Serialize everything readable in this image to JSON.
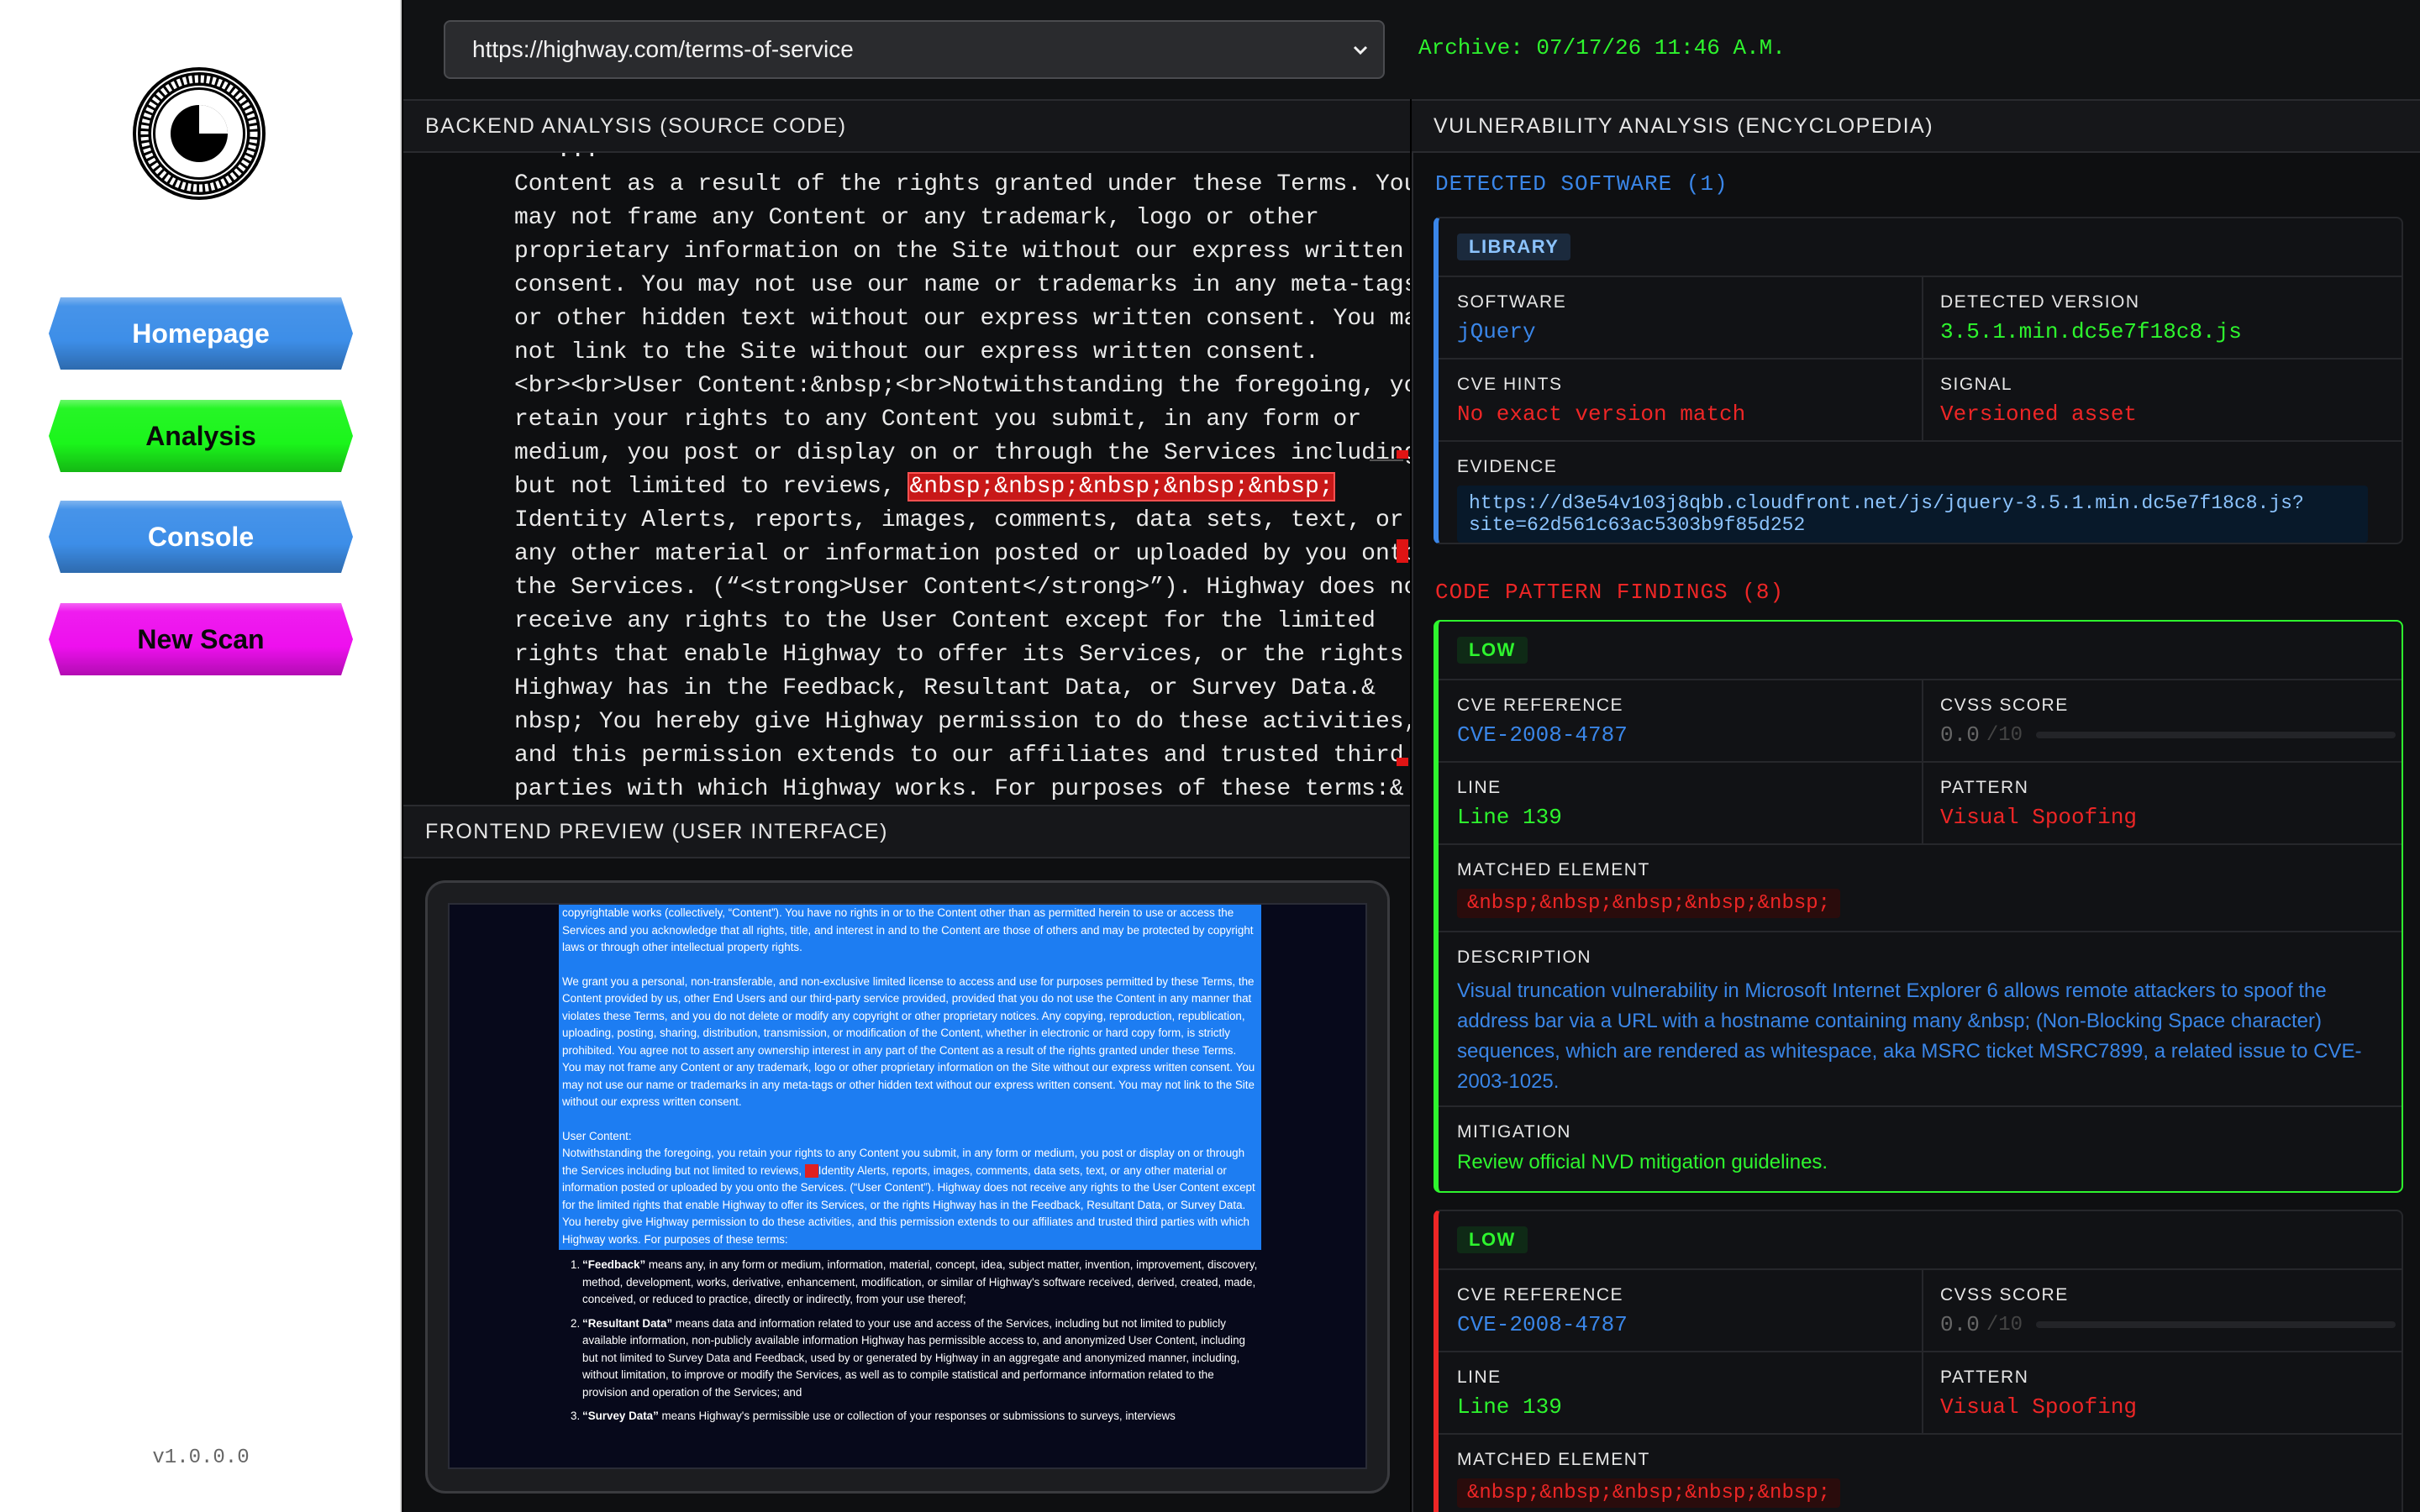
{
  "sidebar": {
    "nav": [
      {
        "label": "Homepage"
      },
      {
        "label": "Analysis"
      },
      {
        "label": "Console"
      },
      {
        "label": "New Scan"
      }
    ],
    "version": "v1.0.0.0"
  },
  "topbar": {
    "url": "https://highway.com/terms-of-service",
    "archive": "Archive: 07/17/26 11:46 A.M."
  },
  "panels": {
    "backend_title": "BACKEND ANALYSIS (SOURCE CODE)",
    "frontend_title": "FRONTEND PREVIEW (USER INTERFACE)",
    "vuln_title": "VULNERABILITY ANALYSIS (ENCYCLOPEDIA)"
  },
  "code": {
    "lines": [
      "Content as a result of the rights granted under these Terms. You",
      "may not frame any Content or any trademark, logo or other",
      "proprietary information on the Site without our express written",
      "consent. You may not use our name or trademarks in any meta-tags",
      "or other hidden text without our express written consent. You may",
      "not link to the Site without our express written consent.",
      "<br><br>User Content:&nbsp;<br>Notwithstanding the foregoing, you",
      "retain your rights to any Content you submit, in any form or",
      "medium, you post or display on or through the Services including"
    ],
    "highlight_prefix": "but not limited to reviews, ",
    "highlight_text": "&nbsp;&nbsp;&nbsp;&nbsp;&nbsp;",
    "lines_after": [
      "Identity Alerts, reports, images, comments, data sets, text, or",
      "any other material or information posted or uploaded by you onto",
      "the Services. (“<strong>User Content</strong>”). Highway does not",
      "receive any rights to the User Content except for the limited",
      "rights that enable Highway to offer its Services, or the rights",
      "Highway has in the Feedback, Resultant Data, or Survey Data.&",
      "nbsp; You hereby give Highway permission to do these activities,",
      "and this permission extends to our affiliates and trusted third",
      "parties with which Highway works. For purposes of these terms:&"
    ]
  },
  "preview": {
    "p1": "copyrightable works (collectively, “Content”). You have no rights in or to the Content other than as permitted herein to use or access the Services and you acknowledge that all rights, title, and interest in and to the Content are those of others and may be protected by copyright laws or through other intellectual property rights.",
    "p2": "We grant you a personal, non-transferable, and non-exclusive limited license to access and use for purposes permitted by these Terms, the Content provided by us, other End Users and our third-party service provided, provided that you do not use the Content in any manner that violates these Terms, and you do not delete or modify any copyright or other proprietary notices. Any copying, reproduction, republication, uploading, posting, sharing, distribution, transmission, or modification of the Content, whether in electronic or hard copy form, is strictly prohibited. You agree not to assert any ownership interest in any part of the Content as a result of the rights granted under these Terms. You may not frame any Content or any trademark, logo or other proprietary information on the Site without our express written consent. You may not use our name or trademarks in any meta-tags or other hidden text without our express written consent. You may not link to the Site without our express written consent.",
    "uc_heading": "User Content:",
    "p3a": "Notwithstanding the foregoing, you retain your rights to any Content you submit, in any form or medium, you post or display on or through the Services including but not limited to reviews, ",
    "p3b": "Identity Alerts, reports, images, comments, data sets, text, or any other material or information posted or uploaded by you onto the Services. (“User Content”). Highway does not receive any rights to the User Content except for the limited rights that enable Highway to offer its Services, or the rights Highway has in the Feedback, Resultant Data, or Survey Data.  You hereby give Highway permission to do these activities, and this permission extends to our affiliates and trusted third parties with which Highway works. For purposes of these terms:",
    "li1_num": "1.",
    "li1_bold": "“Feedback”",
    "li1": " means any, in any form or medium, information, material, concept, idea, subject matter, invention, improvement, discovery, method, development, works, derivative, enhancement, modification, or similar of Highway's software received, derived, created, made, conceived, or reduced to practice, directly or indirectly, from your use thereof;",
    "li2_num": "2.",
    "li2_bold": "“Resultant Data”",
    "li2": " means data and information related to your use and access of the Services, including but not limited to publicly available information, non-publicly available information Highway has permissible access to, and anonymized User Content, including but not limited to Survey Data and Feedback, used by or generated by Highway in an aggregate and anonymized manner, including, without limitation, to improve or modify the Services, as well as to compile statistical and performance information related to the provision and operation of the Services; and",
    "li3_num": "3.",
    "li3_bold": "“Survey Data”",
    "li3": " means Highway's permissible use or collection of your responses or submissions to surveys, interviews"
  },
  "vuln": {
    "detected_title": "DETECTED SOFTWARE (1)",
    "library_badge": "LIBRARY",
    "software_label": "SOFTWARE",
    "software_value": "jQuery",
    "version_label": "DETECTED VERSION",
    "version_value": "3.5.1.min.dc5e7f18c8.js",
    "cve_hints_label": "CVE HINTS",
    "cve_hints_value": "No exact version match",
    "signal_label": "SIGNAL",
    "signal_value": "Versioned asset",
    "evidence_label": "EVIDENCE",
    "evidence_value": "https://d3e54v103j8qbb.cloudfront.net/js/jquery-3.5.1.min.dc5e7f18c8.js?site=62d561c63ac5303b9f85d252",
    "findings_title": "CODE PATTERN FINDINGS (8)",
    "findings": [
      {
        "severity": "LOW",
        "cve_label": "CVE REFERENCE",
        "cve": "CVE-2008-4787",
        "cvss_label": "CVSS SCORE",
        "cvss": "0.0",
        "cvss_max": "/10",
        "line_label": "LINE",
        "line": "Line 139",
        "pattern_label": "PATTERN",
        "pattern": "Visual Spoofing",
        "matched_label": "MATCHED ELEMENT",
        "matched": "&nbsp;&nbsp;&nbsp;&nbsp;&nbsp;",
        "desc_label": "DESCRIPTION",
        "desc": "Visual truncation vulnerability in Microsoft Internet Explorer 6 allows remote attackers to spoof the address bar via a URL with a hostname containing many &nbsp; (Non-Blocking Space character) sequences, which are rendered as whitespace, aka MSRC ticket MSRC7899, a related issue to CVE-2003-1025.",
        "mitigation_label": "MITIGATION",
        "mitigation": "Review official NVD mitigation guidelines."
      },
      {
        "severity": "LOW",
        "cve_label": "CVE REFERENCE",
        "cve": "CVE-2008-4787",
        "cvss_label": "CVSS SCORE",
        "cvss": "0.0",
        "cvss_max": "/10",
        "line_label": "LINE",
        "line": "Line 139",
        "pattern_label": "PATTERN",
        "pattern": "Visual Spoofing",
        "matched_label": "MATCHED ELEMENT",
        "matched": "&nbsp;&nbsp;&nbsp;&nbsp;&nbsp;"
      }
    ]
  },
  "colors": {
    "accent_green": "#2ef52e",
    "accent_blue": "#3a86e8",
    "alert_red": "#ee2626",
    "nav_blue": "#3d8ee8",
    "nav_green": "#1bf51b",
    "nav_magenta": "#ee10ee"
  },
  "icons": {
    "logo": "greek-key-clock-logo",
    "url_dropdown": "chevron-down-icon"
  }
}
